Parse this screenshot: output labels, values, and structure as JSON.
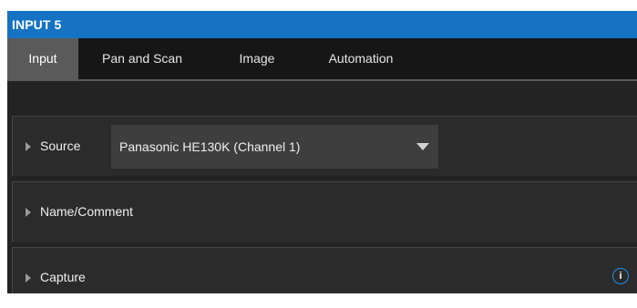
{
  "window": {
    "title": "INPUT 5"
  },
  "tabs": [
    {
      "label": "Input",
      "active": true
    },
    {
      "label": "Pan and Scan",
      "active": false
    },
    {
      "label": "Image",
      "active": false
    },
    {
      "label": "Automation",
      "active": false
    }
  ],
  "sections": {
    "source": {
      "label": "Source",
      "selected": "Panasonic HE130K (Channel 1)"
    },
    "name_comment": {
      "label": "Name/Comment"
    },
    "capture": {
      "label": "Capture",
      "info_glyph": "i"
    }
  },
  "icons": {
    "expand": "triangle-right-icon",
    "dropdown": "chevron-down-icon",
    "info": "info-icon"
  },
  "colors": {
    "title_bar": "#1673c4",
    "active_tab": "#5a5a5a",
    "tab_strip": "#161616",
    "background": "#232323",
    "panel": "#2b2b2b",
    "info_accent": "#1e8ff0"
  }
}
